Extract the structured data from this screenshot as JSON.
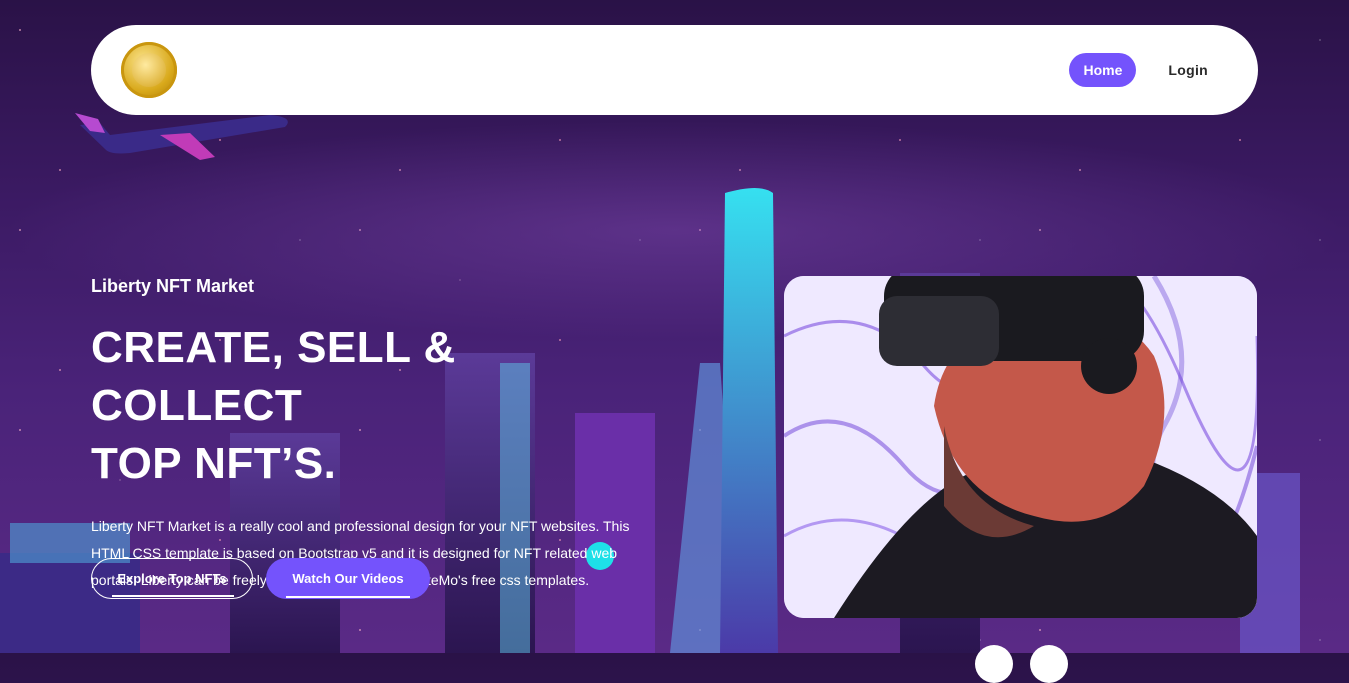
{
  "nav": {
    "home_label": "Home",
    "login_label": "Login"
  },
  "hero": {
    "eyebrow": "Liberty NFT Market",
    "headline_line1": "CREATE, SELL & COLLECT",
    "headline_line2": "TOP NFT’S.",
    "description": "Liberty NFT Market is a really cool and professional design for your NFT websites. This HTML CSS template is based on Bootstrap v5 and it is designed for NFT related web portals. Liberty can be freely downloaded from TemplateMo's free css templates.",
    "explore_button": "Explore Top NFTs",
    "watch_button": "Watch Our Videos"
  },
  "colors": {
    "accent": "#7453fc",
    "background": "#3b1a63"
  },
  "icons": {
    "logo": "gold-coin-logo-icon",
    "plane": "airplane-icon"
  }
}
